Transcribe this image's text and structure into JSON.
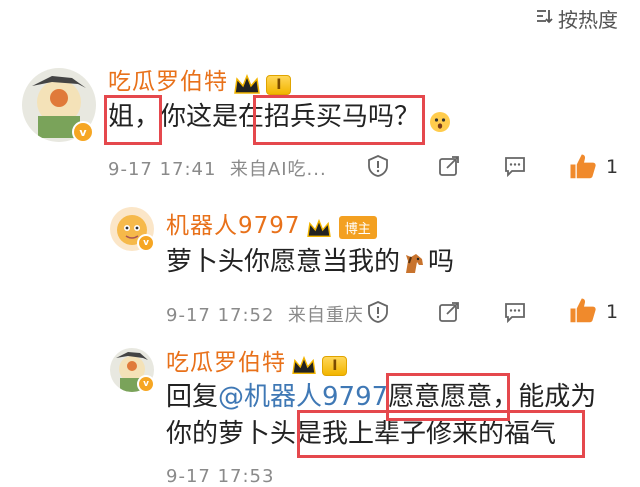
{
  "sort_label": "按热度",
  "comments": [
    {
      "username": "吃瓜罗伯特",
      "level": "I",
      "text_a": "姐，",
      "text_b": "你这是在",
      "text_c": "招兵买马吗？",
      "time": "9-17 17:41",
      "source": "来自AI吃...",
      "likes": "1"
    },
    {
      "username": "机器人9797",
      "badge": "博主",
      "text_a": "萝卜头你愿意当我的",
      "text_b": "吗",
      "time": "9-17 17:52",
      "source": "来自重庆",
      "likes": "1"
    },
    {
      "username": "吃瓜罗伯特",
      "level": "I",
      "reply_prefix": "回复",
      "mention": "@机器人9797",
      "text_a": "愿意愿意",
      "text_b": "，能成为",
      "line2_a": "你的萝卜头",
      "line2_b": "是我上辈子修来的福气",
      "time": "9-17 17:53"
    }
  ],
  "colors": {
    "username": "#e8711a",
    "mention": "#3f78b5",
    "highlight": "#e5484d",
    "like": "#f08a2c"
  }
}
